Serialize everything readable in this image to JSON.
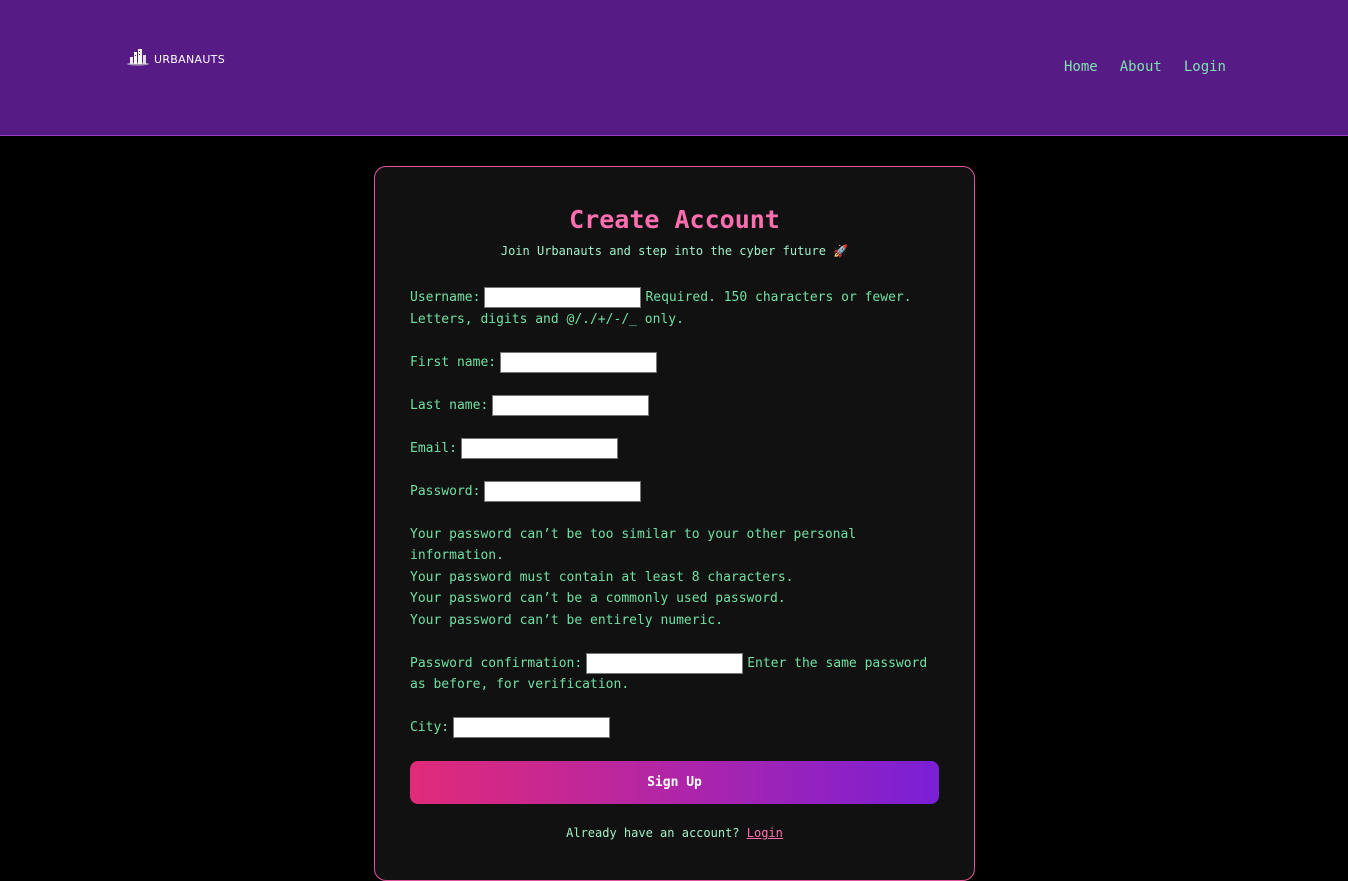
{
  "navbar": {
    "logo_text": "URBANAUTS",
    "links": [
      "Home",
      "About",
      "Login"
    ]
  },
  "card": {
    "title": "Create Account",
    "subtitle": "Join Urbanauts and step into the cyber future 🚀"
  },
  "form": {
    "username": {
      "label": "Username:",
      "value": "",
      "help": "Required. 150 characters or fewer. Letters, digits and @/./+/-/_ only."
    },
    "first_name": {
      "label": "First name:",
      "value": ""
    },
    "last_name": {
      "label": "Last name:",
      "value": ""
    },
    "email": {
      "label": "Email:",
      "value": ""
    },
    "password": {
      "label": "Password:",
      "value": ""
    },
    "password_help": [
      "Your password can’t be too similar to your other personal information.",
      "Your password must contain at least 8 characters.",
      "Your password can’t be a commonly used password.",
      "Your password can’t be entirely numeric."
    ],
    "password_confirmation": {
      "label": "Password confirmation:",
      "value": "",
      "help": "Enter the same password as before, for verification."
    },
    "city": {
      "label": "City:",
      "value": ""
    },
    "submit_label": "Sign Up"
  },
  "footer": {
    "prompt": "Already have an account?",
    "link_label": "Login"
  },
  "colors": {
    "navbar_bg": "#561b85",
    "card_border": "#e0559b",
    "title": "#ff6fb0",
    "text_green": "#6fe0a4"
  }
}
